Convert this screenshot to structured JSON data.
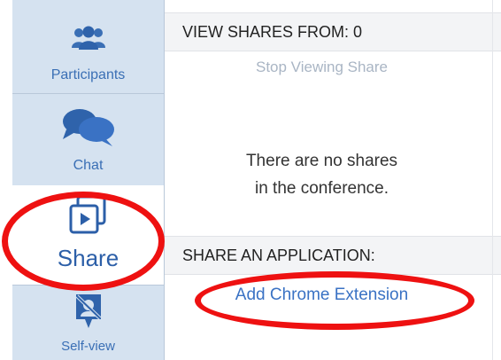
{
  "sidebar": {
    "items": [
      {
        "id": "participants",
        "label": "Participants",
        "icon": "participants-icon"
      },
      {
        "id": "chat",
        "label": "Chat",
        "icon": "chat-bubbles-icon"
      },
      {
        "id": "share",
        "label": "Share",
        "icon": "share-screen-icon",
        "active": true
      },
      {
        "id": "selfview",
        "label": "Self-view",
        "icon": "camera-off-icon"
      }
    ]
  },
  "main": {
    "view_shares_header": "VIEW SHARES FROM: 0",
    "stop_viewing_label": "Stop Viewing Share",
    "empty_message_line1": "There are no shares",
    "empty_message_line2": "in the conference.",
    "share_application_header": "SHARE AN APPLICATION:",
    "add_extension_link": "Add Chrome Extension"
  },
  "colors": {
    "sidebar_bg": "#d5e2f0",
    "accent": "#3a6fb5",
    "highlight_ring": "#ee1111",
    "link": "#3a72c4",
    "disabled_text": "#a9b5c4"
  }
}
